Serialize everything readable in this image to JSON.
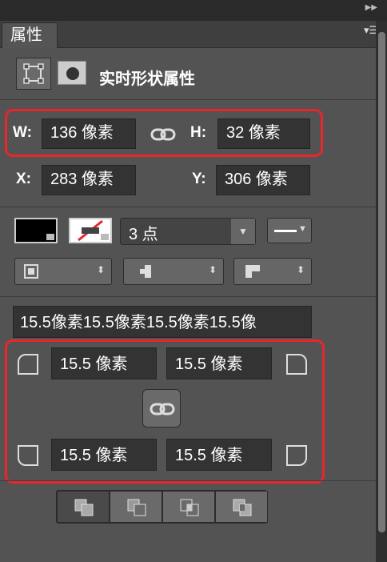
{
  "panel": {
    "tab_label": "属性",
    "title": "实时形状属性"
  },
  "size": {
    "w_label": "W:",
    "w_value": "136 像素",
    "h_label": "H:",
    "h_value": "32 像素"
  },
  "position": {
    "x_label": "X:",
    "x_value": "283 像素",
    "y_label": "Y:",
    "y_value": "306 像素"
  },
  "stroke": {
    "width_value": "3 点"
  },
  "radius": {
    "summary": "15.5像素15.5像素15.5像素15.5像",
    "top_left": "15.5 像素",
    "top_right": "15.5 像素",
    "bottom_left": "15.5 像素",
    "bottom_right": "15.5 像素"
  },
  "colors": {
    "panel": "#535353",
    "field": "#333333",
    "highlight": "#e8262b"
  },
  "icons": [
    "shape-bounds-icon",
    "mask-icon",
    "link-icon",
    "stroke-swatch-icon",
    "path-ops-icon"
  ]
}
